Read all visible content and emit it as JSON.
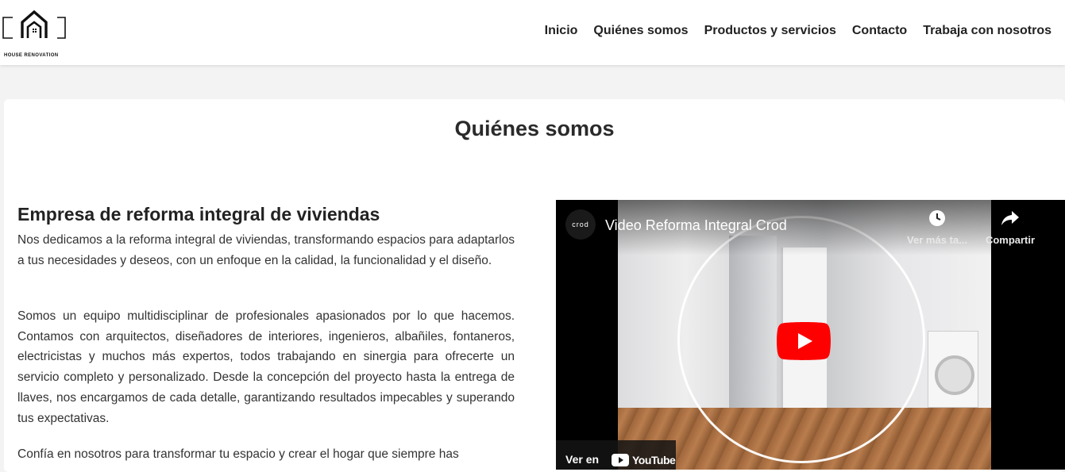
{
  "header": {
    "logo_text": "HOUSE RENOVATION",
    "nav": [
      {
        "label": "Inicio"
      },
      {
        "label": "Quiénes somos"
      },
      {
        "label": "Productos y servicios"
      },
      {
        "label": "Contacto"
      },
      {
        "label": "Trabaja con nosotros"
      }
    ]
  },
  "main": {
    "title": "Quiénes somos",
    "section_heading": "Empresa de reforma integral de viviendas",
    "paragraphs": [
      "Nos dedicamos a la reforma integral de viviendas, transformando espacios para adaptarlos a tus necesidades y deseos, con un enfoque en la calidad, la funcionalidad y el diseño.",
      "Somos un equipo multidisciplinar de profesionales apasionados por lo que hacemos. Contamos con arquitectos, diseñadores de interiores, ingenieros, albañiles, fontaneros, electricistas y muchos más expertos, todos trabajando en sinergia para ofrecerte un servicio completo y personalizado. Desde la concepción del proyecto hasta la entrega de llaves, nos encargamos de cada detalle, garantizando resultados impecables y superando tus expectativas.",
      "Confía en nosotros para transformar tu espacio y crear el hogar que siempre has"
    ]
  },
  "video": {
    "channel_label": "crod",
    "title": "Video Reforma Integral Crod",
    "watch_later_label": "Ver más ta...",
    "share_label": "Compartir",
    "watch_on_label": "Ver en",
    "youtube_word": "YouTube"
  },
  "colors": {
    "youtube_red": "#ff0000",
    "page_background": "#f3f3f3",
    "card_background": "#ffffff"
  }
}
